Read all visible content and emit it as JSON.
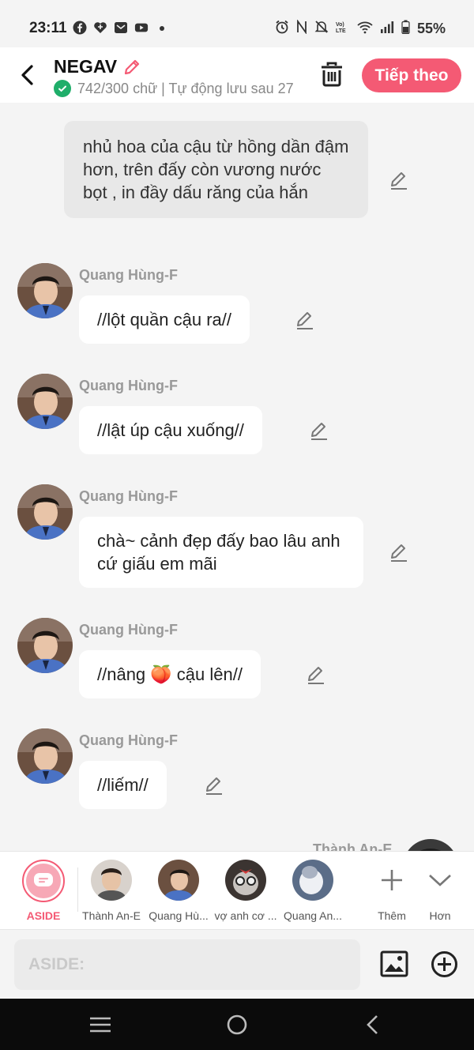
{
  "status_bar": {
    "time": "23:11",
    "battery": "55%",
    "left_icons": [
      "facebook-icon",
      "heart-app-icon",
      "mail-app-icon",
      "youtube-icon",
      "dot-icon"
    ],
    "right_icons": [
      "alarm-icon",
      "nfc-icon",
      "mute-icon",
      "volte-icon",
      "wifi-icon",
      "signal-icon",
      "battery-icon"
    ]
  },
  "header": {
    "title": "NEGAV",
    "subtitle": "742/300 chữ | Tự động lưu sau 27",
    "next_label": "Tiếp theo"
  },
  "messages": [
    {
      "type": "narration",
      "text": "nhủ hoa của cậu từ hồng dần đậm hơn, trên đấy còn vương nước bọt , in đầy dấu răng của hắn"
    },
    {
      "type": "chat",
      "sender": "Quang Hùng-F",
      "text": "//lột quần cậu ra//"
    },
    {
      "type": "chat",
      "sender": "Quang Hùng-F",
      "text": "//lật úp cậu xuống//"
    },
    {
      "type": "chat",
      "sender": "Quang Hùng-F",
      "text": "chà~ cảnh đẹp đấy bao lâu anh cứ giấu em mãi"
    },
    {
      "type": "chat",
      "sender": "Quang Hùng-F",
      "text": "//nâng 🍑 cậu lên//"
    },
    {
      "type": "chat",
      "sender": "Quang Hùng-F",
      "text": "//liếm//"
    },
    {
      "type": "chat",
      "sender": "Thành An-E",
      "text": ""
    }
  ],
  "characters": [
    {
      "label": "ASIDE",
      "selected": true
    },
    {
      "label": "Thành An-E"
    },
    {
      "label": "Quang Hù..."
    },
    {
      "label": "vợ anh cơ ..."
    },
    {
      "label": "Quang An..."
    }
  ],
  "actions": {
    "add_label": "Thêm",
    "more_label": "Hơn"
  },
  "input": {
    "placeholder": "ASIDE:"
  },
  "colors": {
    "accent": "#f45a74",
    "check_green": "#1fae6a"
  }
}
